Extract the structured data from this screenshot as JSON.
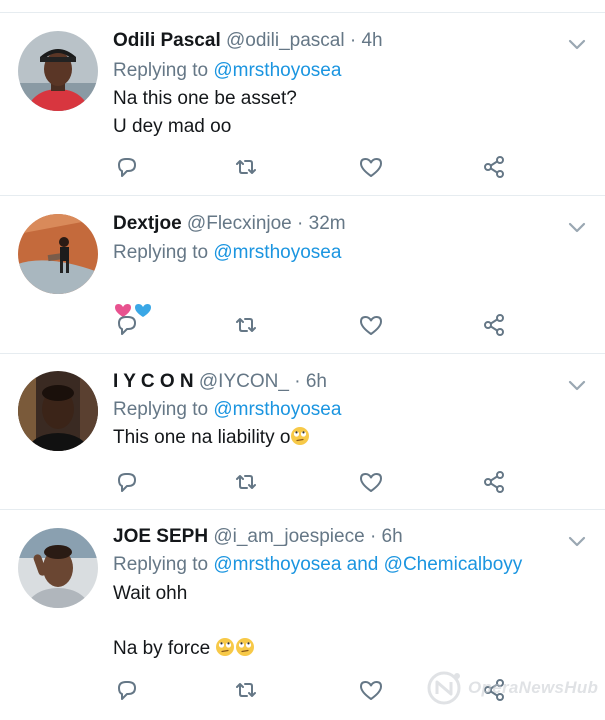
{
  "tweets": [
    {
      "name": "Odili Pascal",
      "handle": "@odili_pascal",
      "separator": "·",
      "time": "4h",
      "replying_prefix": "Replying to",
      "replying_to": "@mrsthoyosea",
      "body": "Na this one be asset?\nU dey mad oo"
    },
    {
      "name": "Dextjoe",
      "handle": "@Flecxinjoe",
      "separator": "·",
      "time": "32m",
      "replying_prefix": "Replying to",
      "replying_to": "@mrsthoyosea",
      "body_emoji": [
        "pink-heart-emoji",
        "blue-heart-emoji"
      ]
    },
    {
      "name": "I Y C O N",
      "handle": "@IYCON_",
      "separator": "·",
      "time": "6h",
      "replying_prefix": "Replying to",
      "replying_to": "@mrsthoyosea",
      "body": "This one na liability o",
      "body_emoji": [
        "face-with-rolling-eyes-emoji"
      ]
    },
    {
      "name": "JOE SEPH",
      "handle": "@i_am_joespiece",
      "separator": "·",
      "time": "6h",
      "replying_prefix": "Replying to",
      "replying_to": "@mrsthoyosea and @Chemicalboyy",
      "body_line1": "Wait ohh",
      "body_line2": "Na by force",
      "body_emoji": [
        "face-with-rolling-eyes-emoji",
        "face-with-rolling-eyes-emoji"
      ]
    }
  ],
  "icons": {
    "reply": "reply-icon",
    "retweet": "retweet-icon",
    "like": "heart-icon",
    "share": "share-icon",
    "menu": "chevron-down-icon"
  },
  "colors": {
    "mention": "#1b95e0",
    "secondary_text": "#657786",
    "icon": "#657786",
    "divider": "#e6ecf0"
  },
  "watermark": {
    "text": "OperaNewsHub"
  }
}
